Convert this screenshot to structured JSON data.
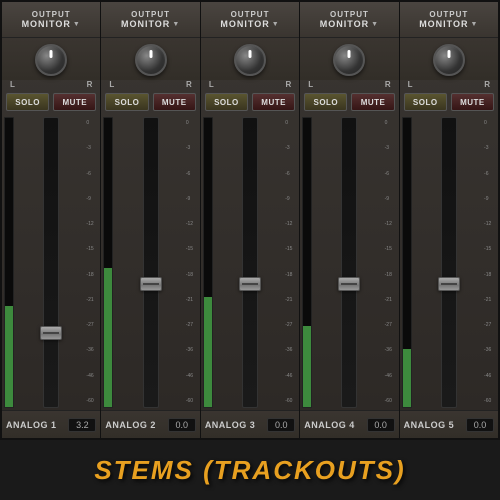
{
  "channels": [
    {
      "id": "ch1",
      "header_top": "OUTPUT",
      "header_bottom": "MONITOR",
      "lr_left": "L",
      "lr_right": "R",
      "solo_label": "SOLO",
      "mute_label": "MUTE",
      "fader_position_pct": 72,
      "value": "3.2",
      "name": "ANALOG 1",
      "vu_level": 35,
      "scale": [
        "0",
        "-3",
        "-6",
        "-9",
        "-12",
        "-15",
        "-18",
        "-21",
        "-27",
        "-36",
        "-46",
        "-60"
      ]
    },
    {
      "id": "ch2",
      "header_top": "OUTPUT",
      "header_bottom": "MONITOR",
      "lr_left": "L",
      "lr_right": "R",
      "solo_label": "SOLO",
      "mute_label": "MUTE",
      "fader_position_pct": 55,
      "value": "0.0",
      "name": "ANALOG 2",
      "vu_level": 48,
      "scale": [
        "0",
        "-3",
        "-6",
        "-9",
        "-12",
        "-15",
        "-18",
        "-21",
        "-27",
        "-36",
        "-46",
        "-60"
      ]
    },
    {
      "id": "ch3",
      "header_top": "OUTPUT",
      "header_bottom": "MONITOR",
      "lr_left": "L",
      "lr_right": "R",
      "solo_label": "SOLO",
      "mute_label": "MUTE",
      "fader_position_pct": 55,
      "value": "0.0",
      "name": "ANALOG 3",
      "vu_level": 38,
      "scale": [
        "0",
        "-3",
        "-6",
        "-9",
        "-12",
        "-15",
        "-18",
        "-21",
        "-27",
        "-36",
        "-46",
        "-60"
      ]
    },
    {
      "id": "ch4",
      "header_top": "OUTPUT",
      "header_bottom": "MONITOR",
      "lr_left": "L",
      "lr_right": "R",
      "solo_label": "SOLO",
      "mute_label": "MUTE",
      "fader_position_pct": 55,
      "value": "0.0",
      "name": "ANALOG 4",
      "vu_level": 28,
      "scale": [
        "0",
        "-3",
        "-6",
        "-9",
        "-12",
        "-15",
        "-18",
        "-21",
        "-27",
        "-36",
        "-46",
        "-60"
      ]
    },
    {
      "id": "ch5",
      "header_top": "OUTPUT",
      "header_bottom": "MONITOR",
      "lr_left": "L",
      "lr_right": "R",
      "solo_label": "SOLO",
      "mute_label": "MUTE",
      "fader_position_pct": 55,
      "value": "0.0",
      "name": "ANALOG 5",
      "vu_level": 20,
      "scale": [
        "0",
        "-3",
        "-6",
        "-9",
        "-12",
        "-15",
        "-18",
        "-21",
        "-27",
        "-36",
        "-46",
        "-60"
      ]
    }
  ],
  "title": "STEMS (TRACKOUTS)",
  "title_color": "#e8a020"
}
